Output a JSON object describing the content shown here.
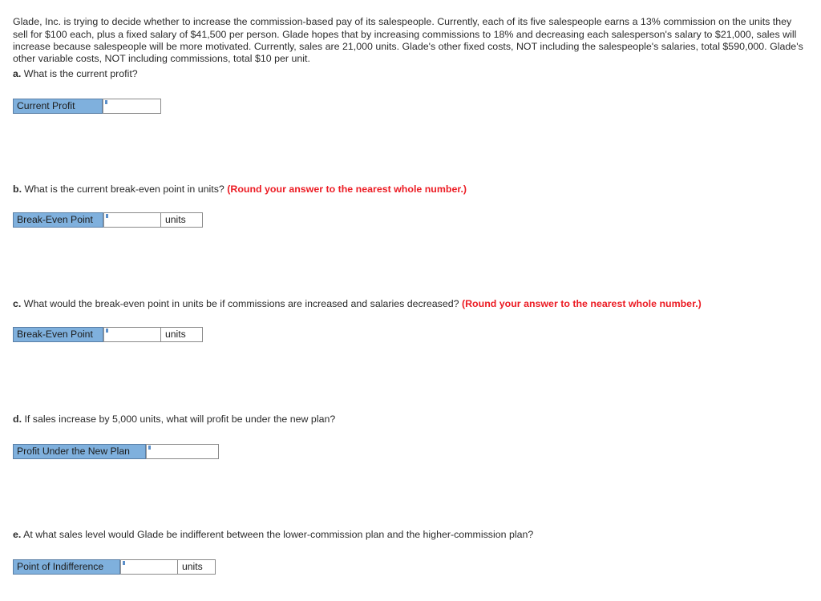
{
  "intro": {
    "paragraph": "Glade, Inc. is trying to decide whether to increase the commission-based pay of its salespeople. Currently, each of its five salespeople earns a 13% commission on the units they sell for $100 each, plus a fixed salary of $41,500 per person. Glade hopes that by increasing commissions to 18% and decreasing each salesperson's salary to $21,000, sales will increase because salespeople will be more motivated. Currently, sales are 21,000 units. Glade's other fixed costs, NOT including the salespeople's salaries, total $590,000. Glade's other variable costs, NOT including commissions, total $10 per unit."
  },
  "round_note": "(Round your answer to the nearest whole number.)",
  "colors": {
    "label_fill": "#7fb0dd",
    "label_border": "#5a7fa6",
    "input_border": "#8a8a8a",
    "note_red": "#ec1c24",
    "text": "#2b2b2b"
  },
  "questions": [
    {
      "id": "a",
      "letter": "a.",
      "text": "What is the current profit?",
      "has_round_note": false,
      "answer": {
        "label": "Current Profit",
        "value": "",
        "placeholder": "",
        "units": ""
      }
    },
    {
      "id": "b",
      "letter": "b.",
      "text": "What is the current break-even point in units?",
      "has_round_note": true,
      "answer": {
        "label": "Break-Even Point",
        "value": "",
        "placeholder": "",
        "units": "units"
      }
    },
    {
      "id": "c",
      "letter": "c.",
      "text": "What would the break-even point in units be if commissions are increased and salaries decreased?",
      "has_round_note": true,
      "answer": {
        "label": "Break-Even Point",
        "value": "",
        "placeholder": "",
        "units": "units"
      }
    },
    {
      "id": "d",
      "letter": "d.",
      "text": "If sales increase by 5,000 units, what will profit be under the new plan?",
      "has_round_note": false,
      "answer": {
        "label": "Profit Under the New Plan",
        "value": "",
        "placeholder": "",
        "units": ""
      }
    },
    {
      "id": "e",
      "letter": "e.",
      "text": "At what sales level would Glade be indifferent between the lower-commission plan and the higher-commission plan?",
      "has_round_note": false,
      "answer": {
        "label": "Point of Indifference",
        "value": "",
        "placeholder": "",
        "units": "units"
      }
    }
  ]
}
